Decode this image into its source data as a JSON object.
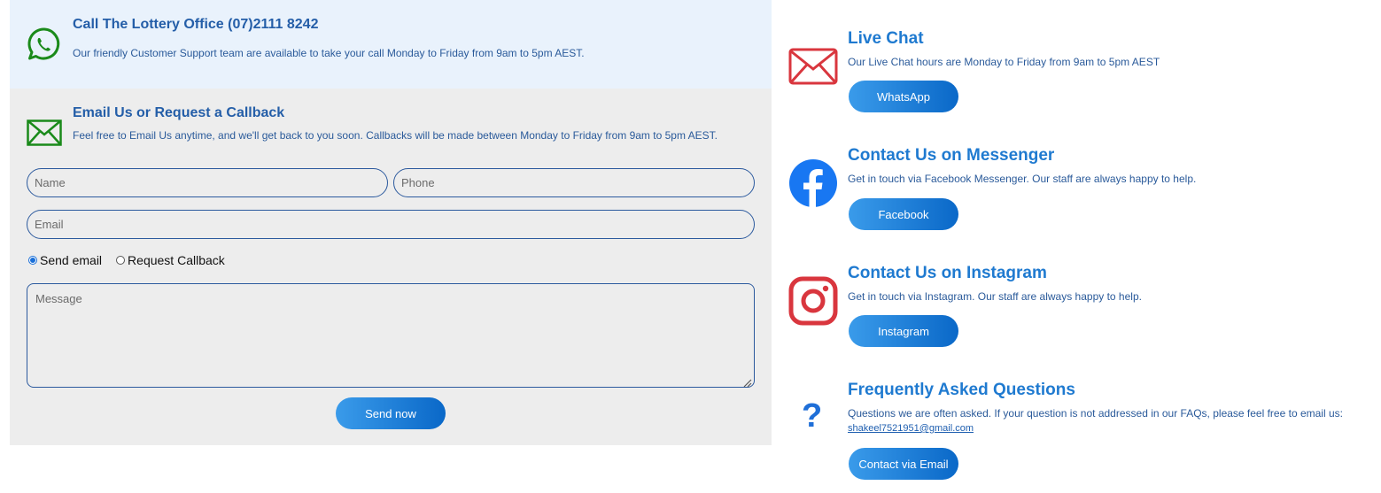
{
  "call": {
    "title": "Call The Lottery Office (07)2111 8242",
    "text": "Our friendly Customer Support team are available to take your call Monday to Friday from 9am to 5pm AEST.",
    "icon": "whatsapp-icon"
  },
  "email": {
    "title": "Email Us or Request a Callback",
    "text": "Feel free to Email Us anytime, and we'll get back to you soon. Callbacks will be made between Monday to Friday from 9am to 5pm AEST.",
    "icon": "envelope-icon"
  },
  "form": {
    "name_placeholder": "Name",
    "phone_placeholder": "Phone",
    "email_placeholder": "Email",
    "radio_send_email": "Send email",
    "radio_request_callback": "Request Callback",
    "selected_option": "Send email",
    "message_placeholder": "Message",
    "submit_label": "Send now"
  },
  "live_chat": {
    "title": "Live Chat",
    "text": "Our Live Chat hours are Monday to Friday from 9am to 5pm AEST",
    "button": "WhatsApp",
    "icon": "envelope-icon"
  },
  "messenger": {
    "title": "Contact Us on Messenger",
    "text": "Get in touch via Facebook Messenger. Our staff are always happy to help.",
    "button": "Facebook",
    "icon": "facebook-icon"
  },
  "instagram": {
    "title": "Contact Us on Instagram",
    "text": "Get in touch via Instagram. Our staff are always happy to help.",
    "button": "Instagram",
    "icon": "instagram-icon"
  },
  "faq": {
    "title": "Frequently Asked Questions",
    "text": "Questions we are often asked. If your question is not addressed in our FAQs, please feel free to email us:",
    "email_link": "shakeel7521951@gmail.com",
    "button": "Contact via Email",
    "icon": "question-mark-icon",
    "icon_glyph": "?"
  },
  "colors": {
    "call_bg": "#e9f2fc",
    "form_bg": "#ededed",
    "green_icon": "#1a8a1a",
    "red_icon": "#d9363e",
    "facebook_blue": "#1877f2",
    "title_blue": "#1f7ad0",
    "button_gradient_start": "#3a9bea",
    "button_gradient_end": "#0a68c8"
  }
}
